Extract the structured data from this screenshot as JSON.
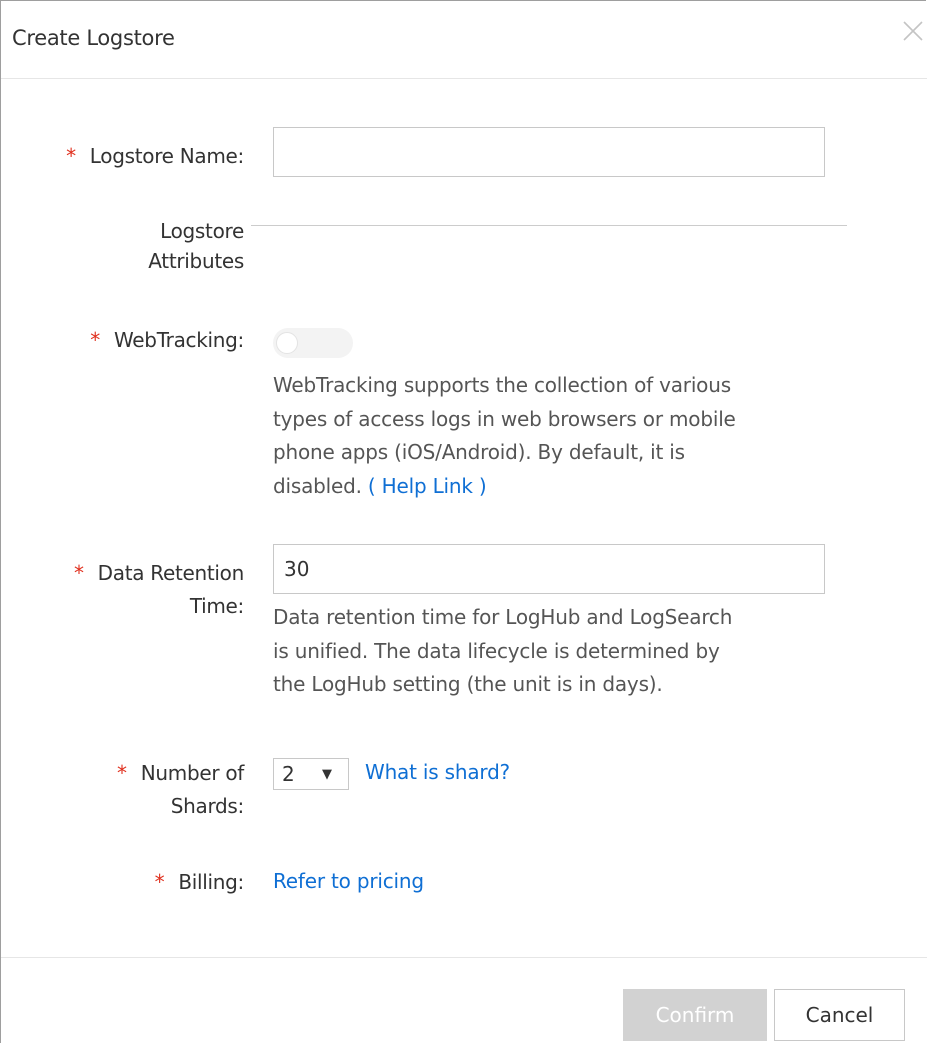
{
  "dialog": {
    "title": "Create Logstore"
  },
  "form": {
    "required_mark": "*",
    "logstore_name": {
      "label": "Logstore Name:",
      "value": ""
    },
    "attributes_section": {
      "label_line1": "Logstore",
      "label_line2": "Attributes"
    },
    "webtracking": {
      "label": "WebTracking:",
      "enabled": false,
      "help_line1": "WebTracking supports the collection of various",
      "help_line2": "types of access logs in web browsers or mobile",
      "help_line3": "phone apps (iOS/Android). By default, it is",
      "help_line4_prefix": "disabled. ",
      "help_link": "( Help Link )"
    },
    "data_retention": {
      "label_line1": "Data Retention",
      "label_line2": "Time:",
      "value": "30",
      "help_line1": "Data retention time for LogHub and LogSearch",
      "help_line2": "is unified. The data lifecycle is determined by",
      "help_line3": "the LogHub setting (the unit is in days)."
    },
    "shards": {
      "label_line1": "Number of",
      "label_line2": "Shards:",
      "selected": "2",
      "caret": "▼",
      "help_link": "What is shard?"
    },
    "billing": {
      "label": "Billing:",
      "link": "Refer to pricing"
    }
  },
  "footer": {
    "confirm_label": "Confirm",
    "cancel_label": "Cancel"
  },
  "colors": {
    "required": "#e0301e",
    "link": "#0f6fd4",
    "confirm_disabled_bg": "#d2d2d2"
  }
}
